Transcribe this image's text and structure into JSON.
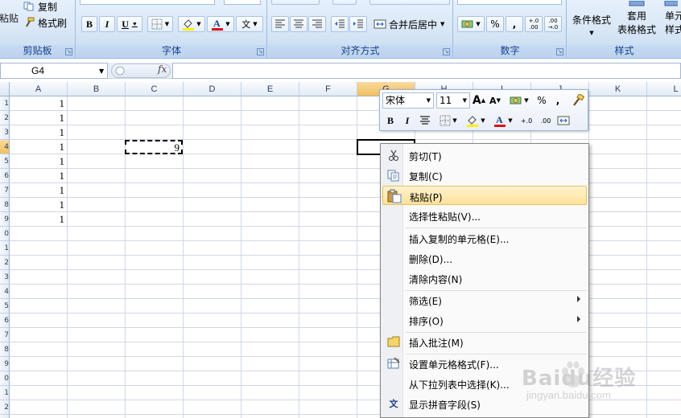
{
  "ribbon": {
    "clipboard": {
      "paste_label": "粘贴",
      "copy_label": "复制",
      "format_painter_label": "格式刷",
      "group_label": "剪贴板"
    },
    "font": {
      "bold": "B",
      "italic": "I",
      "underline": "U",
      "phonetic": "文",
      "group_label": "字体",
      "font_color": "#e01010",
      "fill_color": "#ffef00"
    },
    "alignment": {
      "merge_center_label": "合并后居中",
      "group_label": "对齐方式"
    },
    "number": {
      "percent": "%",
      "comma": ",",
      "inc_decimal": "+.0 .00",
      "dec_decimal": ".00 →.0",
      "group_label": "数字"
    },
    "styles": {
      "conditional_format_label": "条件格式",
      "table_format_label_1": "套用",
      "table_format_label_2": "表格格式",
      "cell_styles_label_1": "单元",
      "cell_styles_label_2": "样式",
      "group_label": "样式"
    }
  },
  "formula_bar": {
    "name_box": "G4",
    "fx": "fx",
    "formula": ""
  },
  "grid": {
    "columns": [
      "A",
      "B",
      "C",
      "D",
      "E",
      "F",
      "G",
      "H",
      "I",
      "J",
      "K",
      "L"
    ],
    "active_column": "G",
    "row_numbers": [
      "1",
      "2",
      "3",
      "4",
      "5",
      "6",
      "7",
      "8",
      "9",
      "0",
      "1",
      "2",
      "3",
      "4",
      "5",
      "6",
      "7",
      "8",
      "9",
      "0",
      "1",
      "2",
      "3"
    ],
    "active_row_index": 3,
    "column_a_values": [
      "1",
      "1",
      "1",
      "1",
      "1",
      "1",
      "1",
      "1",
      "1"
    ],
    "copied_cell": {
      "ref": "C4",
      "value": "9"
    }
  },
  "mini_toolbar": {
    "font_name": "宋体",
    "font_size": "11",
    "grow_font": "A",
    "shrink_font": "A",
    "percent": "%",
    "comma": ",",
    "bold": "B",
    "italic": "I",
    "inc_decimal": "+.0",
    "dec_decimal": ".00"
  },
  "context_menu": {
    "items": [
      {
        "label": "剪切(T)",
        "icon": "scissors-icon"
      },
      {
        "label": "复制(C)",
        "icon": "copy-icon"
      },
      {
        "label": "粘贴(P)",
        "icon": "paste-icon",
        "highlighted": true
      },
      {
        "label": "选择性粘贴(V)..."
      },
      {
        "label": "插入复制的单元格(E)..."
      },
      {
        "label": "删除(D)..."
      },
      {
        "label": "清除内容(N)"
      },
      {
        "label": "筛选(E)",
        "submenu": true
      },
      {
        "label": "排序(O)",
        "submenu": true
      },
      {
        "label": "插入批注(M)",
        "icon": "comment-icon"
      },
      {
        "label": "设置单元格格式(F)...",
        "icon": "format-cells-icon"
      },
      {
        "label": "从下拉列表中选择(K)..."
      },
      {
        "label": "显示拼音字段(S)",
        "icon": "phonetic-icon"
      }
    ]
  },
  "watermark": {
    "text": "Baidu经验",
    "url": "jingyan.baidu.com"
  },
  "colors": {
    "ribbon_text": "#15428b",
    "active_header": "#f1c15f",
    "menu_highlight": "#fde29a"
  }
}
